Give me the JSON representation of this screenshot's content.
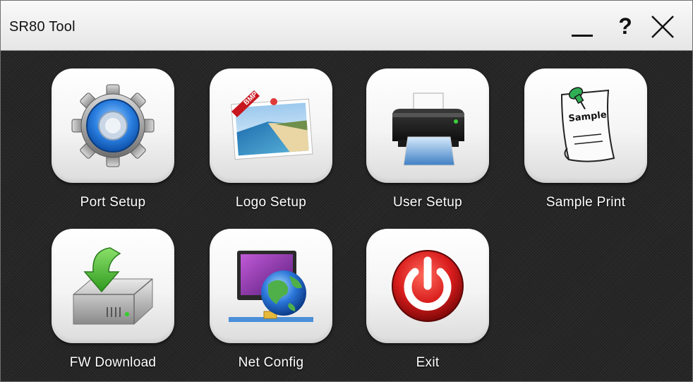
{
  "window": {
    "title": "SR80 Tool",
    "help_label": "?"
  },
  "tiles": [
    {
      "label": "Port Setup",
      "icon": "gear-icon"
    },
    {
      "label": "Logo Setup",
      "icon": "bmp-image-icon",
      "badge": "BMP"
    },
    {
      "label": "User Setup",
      "icon": "printer-icon"
    },
    {
      "label": "Sample Print",
      "icon": "sample-paper-icon",
      "badge": "Sample"
    },
    {
      "label": "FW Download",
      "icon": "download-drive-icon"
    },
    {
      "label": "Net Config",
      "icon": "network-globe-icon"
    },
    {
      "label": "Exit",
      "icon": "power-icon"
    }
  ],
  "colors": {
    "background": "#272727",
    "titlebar": "#eeeeee",
    "tile": "#f4f4f4",
    "label_text": "#ffffff",
    "gear_blue": "#2a7fe0",
    "power_red": "#d81c1c",
    "arrow_green": "#3fae2a"
  }
}
